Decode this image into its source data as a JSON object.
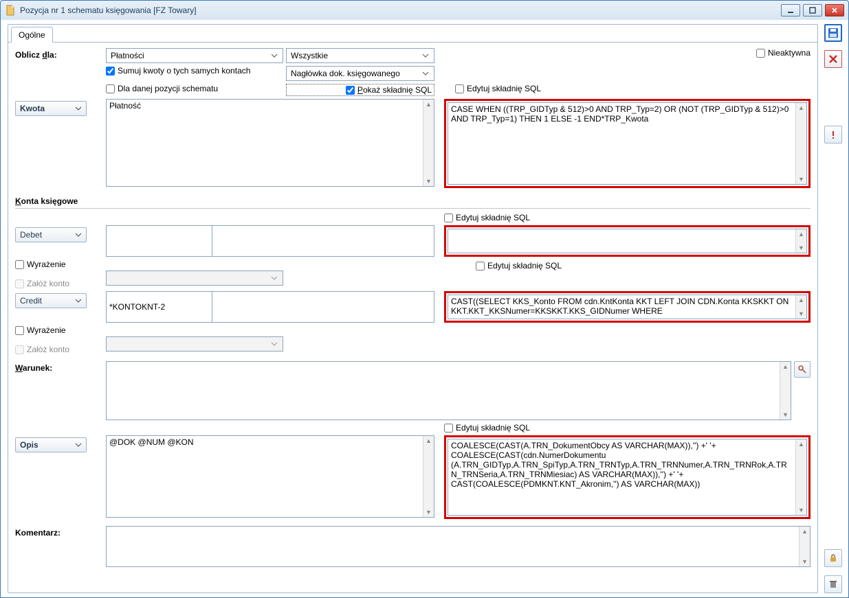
{
  "window": {
    "title": "Pozycja nr 1 schematu księgowania [FZ Towary]"
  },
  "tabs": {
    "general": "Ogólne"
  },
  "labels": {
    "oblicz_dla": "Oblicz dla:",
    "kwota": "Kwota",
    "konta": "Konta księgowe",
    "debet": "Debet",
    "credit": "Credit",
    "warunek": "Warunek:",
    "opis": "Opis",
    "komentarz": "Komentarz:",
    "wyrazenie": "Wyrażenie",
    "zaloz_konto": "Załóż konto",
    "nieaktywna": "Nieaktywna"
  },
  "combos": {
    "platnosci": "Płatności",
    "wszystkie": "Wszystkie",
    "naglowka": "Nagłówka dok. księgowanego"
  },
  "checkboxes": {
    "sumuj": {
      "label": "Sumuj kwoty o tych samych kontach",
      "checked": true
    },
    "dla_pozycji": {
      "label": "Dla danej pozycji schematu",
      "checked": false
    },
    "pokaz_sql": {
      "label": "Pokaż składnię SQL",
      "checked": true
    },
    "edytuj_sql_kwota": {
      "label": "Edytuj składnię SQL",
      "checked": false
    },
    "edytuj_sql_debet": {
      "label": "Edytuj składnię SQL",
      "checked": false
    },
    "edytuj_sql_credit": {
      "label": "Edytuj składnię SQL",
      "checked": false
    },
    "edytuj_sql_opis": {
      "label": "Edytuj składnię SQL",
      "checked": false
    }
  },
  "values": {
    "kwota_text": "Płatność",
    "kwota_sql": "CASE WHEN ((TRP_GIDTyp & 512)>0 AND TRP_Typ=2) OR (NOT (TRP_GIDTyp & 512)>0 AND TRP_Typ=1) THEN 1 ELSE -1 END*TRP_Kwota",
    "debet_val1": "",
    "debet_val2": "",
    "debet_sql": "",
    "credit_val1": "*KONTOKNT-2",
    "credit_val2": "",
    "credit_sql": "CAST((SELECT KKS_Konto FROM cdn.KntKonta KKT LEFT JOIN CDN.Konta KKSKKT ON KKT.KKT_KKSNumer=KKSKKT.KKS_GIDNumer WHERE",
    "warunek": "",
    "opis_text": "@DOK @NUM @KON",
    "opis_sql": "COALESCE(CAST(A.TRN_DokumentObcy AS VARCHAR(MAX)),'') +' '+\nCOALESCE(CAST(cdn.NumerDokumentu\n(A.TRN_GIDTyp,A.TRN_SpiTyp,A.TRN_TRNTyp,A.TRN_TRNNumer,A.TRN_TRNRok,A.TRN_TRNSeria,A.TRN_TRNMiesiac) AS VARCHAR(MAX)),'') +' '+\nCAST(COALESCE(PDMKNT.KNT_Akronim,'') AS VARCHAR(MAX))",
    "komentarz": ""
  }
}
